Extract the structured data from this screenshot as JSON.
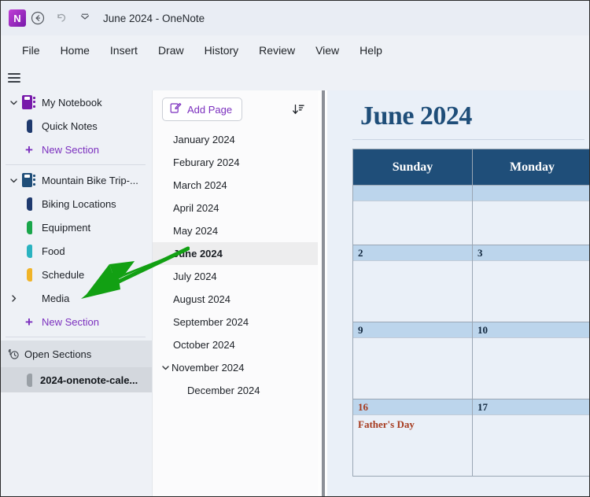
{
  "titlebar": {
    "logo_text": "N",
    "title": "June 2024  -  OneNote",
    "back_icon": "back-arrow-icon",
    "undo_icon": "undo-icon",
    "customize_icon": "chevron-double-down-icon"
  },
  "menubar": {
    "items": [
      {
        "label": "File"
      },
      {
        "label": "Home"
      },
      {
        "label": "Insert"
      },
      {
        "label": "Draw"
      },
      {
        "label": "History"
      },
      {
        "label": "Review"
      },
      {
        "label": "View"
      },
      {
        "label": "Help"
      }
    ]
  },
  "navigation": {
    "notebooks": [
      {
        "label": "My Notebook",
        "icon_color": "#7719aa",
        "expanded": true,
        "sections": [
          {
            "label": "Quick Notes",
            "color": "#1f3a6e"
          }
        ],
        "new_section_label": "New Section"
      },
      {
        "label": "Mountain Bike Trip-...",
        "icon_color": "#1f4e79",
        "expanded": true,
        "sections": [
          {
            "label": "Biking Locations",
            "color": "#1f3a6e"
          },
          {
            "label": "Equipment",
            "color": "#1aa64b"
          },
          {
            "label": "Food",
            "color": "#2bb3c0"
          },
          {
            "label": "Schedule",
            "color": "#f0b429"
          }
        ],
        "group": {
          "label": "Media",
          "expanded": false
        },
        "new_section_label": "New Section"
      }
    ],
    "open_sections_label": "Open Sections",
    "open_file_label": "2024-onenote-cale...",
    "open_file_color": "#9aa0a6"
  },
  "pagelist": {
    "add_page_label": "Add Page",
    "add_page_icon": "new-page-pencil-icon",
    "sort_icon": "sort-descending-icon",
    "pages": [
      {
        "label": "January 2024",
        "selected": false,
        "sub": false,
        "chevron": null
      },
      {
        "label": "Feburary 2024",
        "selected": false,
        "sub": false,
        "chevron": null
      },
      {
        "label": "March 2024",
        "selected": false,
        "sub": false,
        "chevron": null
      },
      {
        "label": "April 2024",
        "selected": false,
        "sub": false,
        "chevron": null
      },
      {
        "label": "May 2024",
        "selected": false,
        "sub": false,
        "chevron": null
      },
      {
        "label": "June 2024",
        "selected": true,
        "sub": false,
        "chevron": null
      },
      {
        "label": "July 2024",
        "selected": false,
        "sub": false,
        "chevron": null
      },
      {
        "label": "August 2024",
        "selected": false,
        "sub": false,
        "chevron": null
      },
      {
        "label": "September 2024",
        "selected": false,
        "sub": false,
        "chevron": null
      },
      {
        "label": "October 2024",
        "selected": false,
        "sub": false,
        "chevron": null
      },
      {
        "label": "November 2024",
        "selected": false,
        "sub": false,
        "chevron": "expanded"
      },
      {
        "label": "December 2024",
        "selected": false,
        "sub": true,
        "chevron": null
      }
    ]
  },
  "calendar": {
    "title": "June 2024",
    "header_color": "#1f4e79",
    "date_band_color": "#bcd5ec",
    "holiday_color": "#a63a1e",
    "columns": [
      "Sunday",
      "Monday"
    ],
    "weeks": [
      {
        "height": "tall",
        "days": [
          {
            "date": "",
            "event": "",
            "holiday": false
          },
          {
            "date": "",
            "event": "",
            "holiday": false
          }
        ]
      },
      {
        "height": "tall",
        "days": [
          {
            "date": "2",
            "event": "",
            "holiday": false
          },
          {
            "date": "3",
            "event": "",
            "holiday": false
          }
        ]
      },
      {
        "height": "tall",
        "days": [
          {
            "date": "9",
            "event": "",
            "holiday": false
          },
          {
            "date": "10",
            "event": "",
            "holiday": false
          }
        ]
      },
      {
        "height": "tall",
        "days": [
          {
            "date": "16",
            "event": "Father's Day",
            "holiday": true
          },
          {
            "date": "17",
            "event": "",
            "holiday": false
          }
        ]
      }
    ]
  },
  "annotation": {
    "arrow_color": "#12a013",
    "name": "green-pointer-arrow"
  }
}
